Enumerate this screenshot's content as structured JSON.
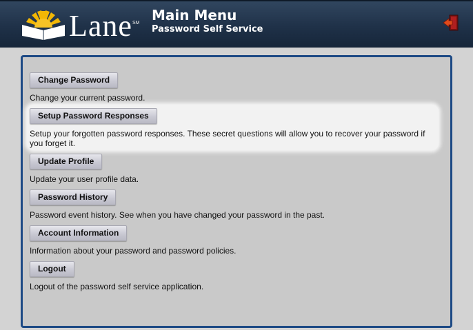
{
  "header": {
    "logo_text": "Lane",
    "logo_mark": "SM",
    "title": "Main Menu",
    "subtitle": "Password Self Service",
    "exit_icon": "exit-door-icon"
  },
  "colors": {
    "header_bg": "#1f3148",
    "panel_border": "#1d4a85",
    "page_bg": "#d3d3d3",
    "highlight_bg": "#f2f2f2",
    "logo_sun": "#f2b705"
  },
  "menu": {
    "items": [
      {
        "label": "Change Password",
        "description": "Change your current password."
      },
      {
        "label": "Setup Password Responses",
        "description": "Setup your forgotten password responses. These secret questions will allow you to recover your password if you forget it."
      },
      {
        "label": "Update Profile",
        "description": "Update your user profile data."
      },
      {
        "label": "Password History",
        "description": "Password event history. See when you have changed your password in the past."
      },
      {
        "label": "Account Information",
        "description": "Information about your password and password policies."
      },
      {
        "label": "Logout",
        "description": "Logout of the password self service application."
      }
    ]
  }
}
